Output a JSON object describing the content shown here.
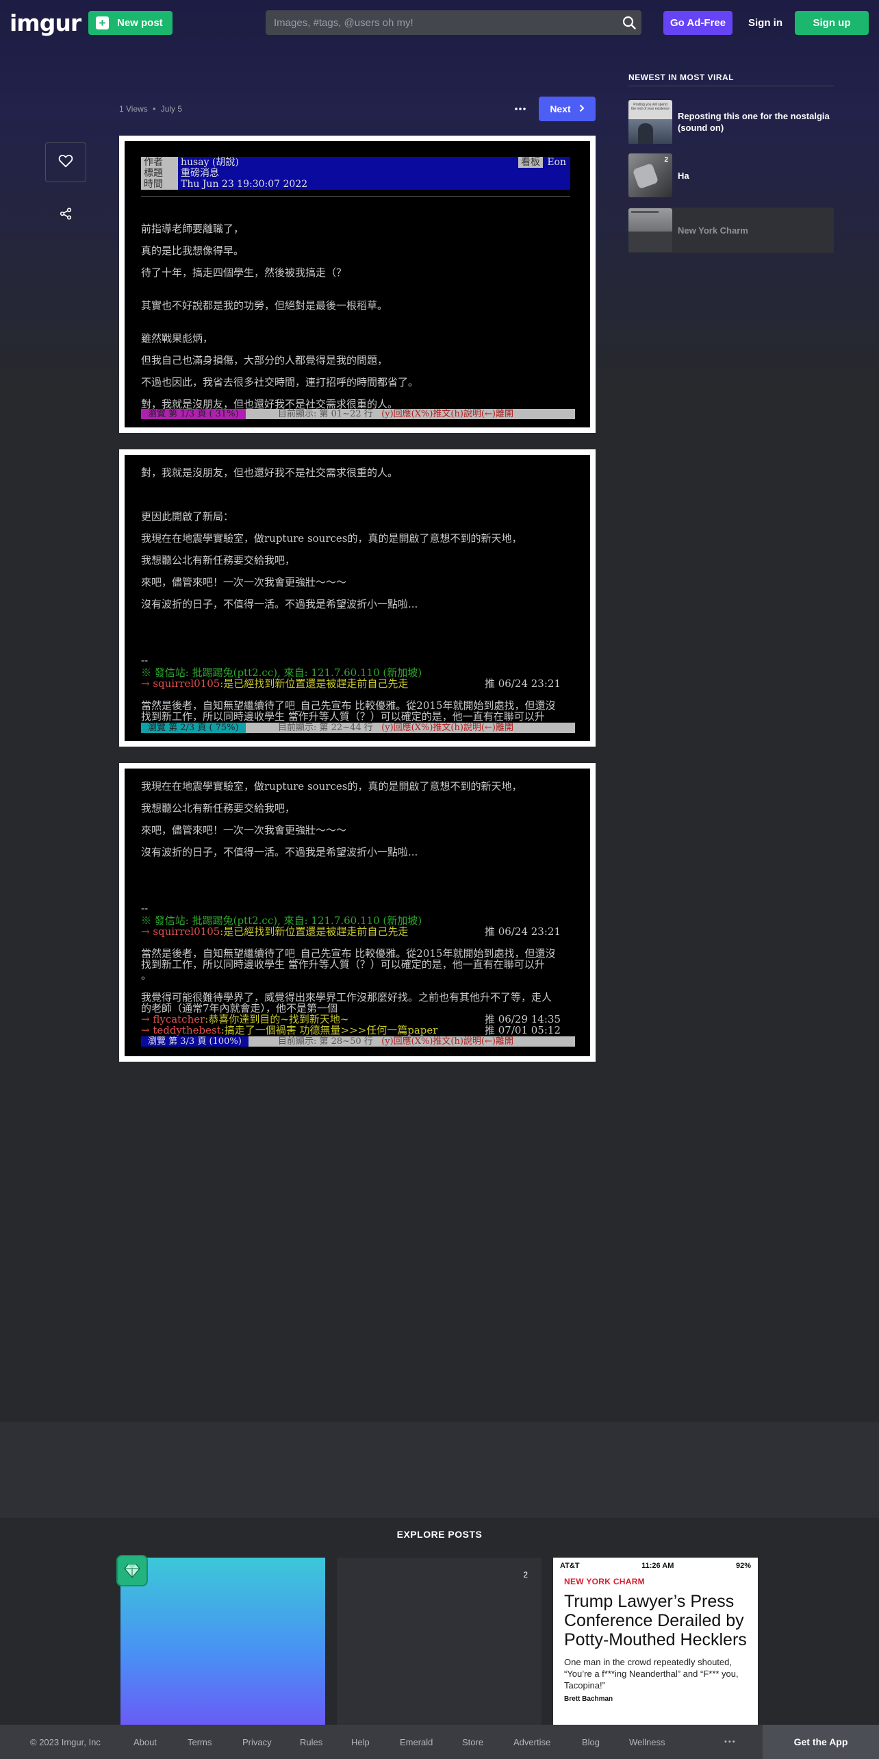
{
  "header": {
    "logo": "imgur",
    "new_post_label": "New post",
    "search_placeholder": "Images, #tags, @users oh my!",
    "ad_free_label": "Go Ad-Free",
    "sign_in_label": "Sign in",
    "sign_up_label": "Sign up"
  },
  "post": {
    "views": "1 Views",
    "separator": "•",
    "date": "July 5",
    "next_label": "Next"
  },
  "image1": {
    "header": {
      "author_key": "作者",
      "author": "husay (胡說)",
      "board_key": "看板",
      "board": "Eon",
      "title_key": "標題",
      "title": "重磅消息",
      "time_key": "時間",
      "time": "Thu Jun 23 19:30:07 2022"
    },
    "lines": [
      "前指導老師要離職了，",
      "真的是比我想像得早。",
      "待了十年，搞走四個學生，然後被我搞走（？",
      "其實也不好說都是我的功勞，但絕對是最後一根稻草。",
      "雖然戰果彪炳，",
      "但我自己也滿身損傷，大部分的人都覺得是我的問題，",
      "不過也因此，我省去很多社交時間，連打招呼的時間都省了。",
      "對，我就是沒朋友，但也還好我不是社交需求很重的人。"
    ],
    "status_left": "瀏覽 第 1/3 頁 ( 31%)",
    "status_right": "目前顯示: 第 01~22 行",
    "status_keys": "(y)回應(X%)推文(h)說明(←)離開"
  },
  "image2": {
    "lines": [
      "對，我就是沒朋友，但也還好我不是社交需求很重的人。",
      "更因此開啟了新局：",
      "我現在在地震學實驗室，做rupture sources的，真的是開啟了意想不到的新天地，",
      "我想聽公北有新任務要交給我吧，",
      "來吧，儘管來吧！一次一次我會更強壯～～～",
      "沒有波折的日子，不值得一活。不過我是希望波折小一點啦..."
    ],
    "sig_dash": "--",
    "sig_from": "※ 發信站: 批踢踢兔(ptt2.cc), 來自: 121.7.60.110 (新加坡)",
    "push1_user": "→ squirrel0105",
    "push1_text": ":是已經找到新位置還是被趕走前自己先走",
    "push1_time": "推 06/24 23:21",
    "reply_line1": "當然是後者，自知無望繼續待了吧_自己先宣布 比較優雅。從2015年就開始到處找，但還沒",
    "reply_line2": "找到新工作，所以同時邊收學生 當作升等人質（？）可以確定的是，他一直有在聯可以升",
    "status_left": "瀏覽 第 2/3 頁 ( 75%)",
    "status_right": "目前顯示: 第 22~44 行",
    "status_keys": "(y)回應(X%)推文(h)說明(←)離開"
  },
  "image3": {
    "lines": [
      "我現在在地震學實驗室，做rupture sources的，真的是開啟了意想不到的新天地，",
      "我想聽公北有新任務要交給我吧，",
      "來吧，儘管來吧！一次一次我會更強壯～～～",
      "沒有波折的日子，不值得一活。不過我是希望波折小一點啦..."
    ],
    "sig_dash": "--",
    "sig_from": "※ 發信站: 批踢踢兔(ptt2.cc), 來自: 121.7.60.110 (新加坡)",
    "push1_user": "→ squirrel0105",
    "push1_text": ":是已經找到新位置還是被趕走前自己先走",
    "push1_time": "推 06/24 23:21",
    "reply_line1": "當然是後者，自知無望繼續待了吧_自己先宣布 比較優雅。從2015年就開始到處找，但還沒",
    "reply_line2": "找到新工作，所以同時邊收學生 當作升等人質（？）可以確定的是，他一直有在聯可以升",
    "reply_line3": "。",
    "reply_line4": "我覺得可能很難待學界了，威覺得出來學界工作沒那麼好找。之前也有其他升不了等，走人",
    "reply_line5": "的老師（通常7年內就會走），他不是第一個",
    "push2_user": "→ flycatcher",
    "push2_text": ":恭喜你達到目的~找到新天地~",
    "push2_time": "推 06/29 14:35",
    "push3_user": "→ teddythebest",
    "push3_text": ":搞走了一個禍害 功德無量>>>任何一篇paper",
    "push3_time": "推 07/01 05:12",
    "status_left": "瀏覽 第 3/3 頁 (100%)",
    "status_right": "目前顯示: 第 28~50 行",
    "status_keys": "(y)回應(X%)推文(h)說明(←)離開"
  },
  "sidebar": {
    "title": "NEWEST IN MOST VIRAL",
    "items": [
      {
        "title": "Reposting this one for the nostalgia (sound on)",
        "thumb_text": "Posting you will spend the rest of your existence"
      },
      {
        "title": "Ha",
        "badge": "2"
      },
      {
        "title": "New York Charm"
      }
    ]
  },
  "explore": {
    "title": "EXPLORE POSTS",
    "card2_badge": "2",
    "article": {
      "carrier": "AT&T",
      "time": "11:26 AM",
      "battery": "92%",
      "kicker": "NEW YORK CHARM",
      "headline": "Trump Lawyer’s Press Conference Derailed by Potty-Mouthed Hecklers",
      "body": "One man in the crowd repeatedly shouted, “You’re a f***ing Neanderthal” and “F*** you, Tacopina!”",
      "byline": "Brett Bachman"
    }
  },
  "footer": {
    "copyright": "© 2023 Imgur, Inc",
    "links": [
      "About",
      "Terms",
      "Privacy",
      "Rules",
      "Help",
      "Emerald",
      "Store",
      "Advertise",
      "Blog",
      "Wellness"
    ],
    "more": "•••",
    "get_app": "Get the App"
  },
  "colors": {
    "brand_green": "#1bb76e",
    "ad_free_purple": "#6644f5",
    "next_blue": "#4d5ef5",
    "ptt_header_blue": "#0a0a9e"
  }
}
